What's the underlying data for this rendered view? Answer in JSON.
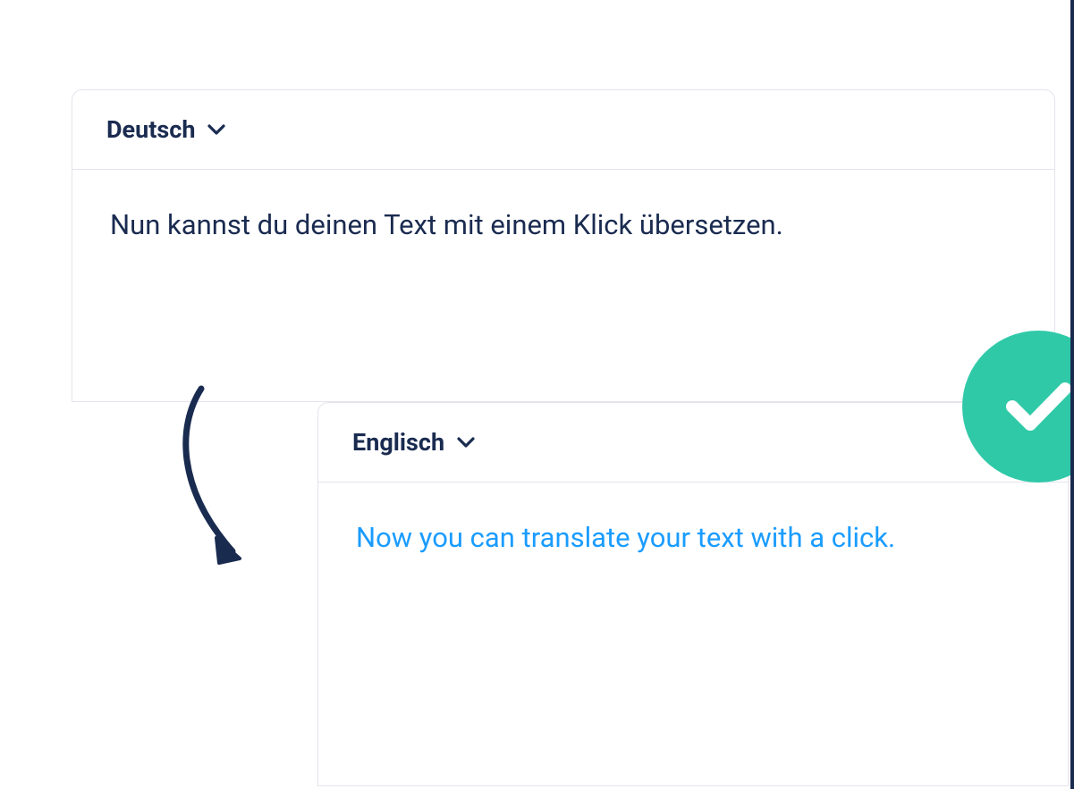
{
  "source": {
    "language_label": "Deutsch",
    "text": "Nun kannst du deinen Text mit einem Klick übersetzen."
  },
  "target": {
    "language_label": "Englisch",
    "text": "Now you can translate your text with a click."
  },
  "colors": {
    "text_dark": "#1a2b50",
    "text_highlight": "#1a9cff",
    "success": "#2fc9a8",
    "border": "#e4e4ed"
  }
}
